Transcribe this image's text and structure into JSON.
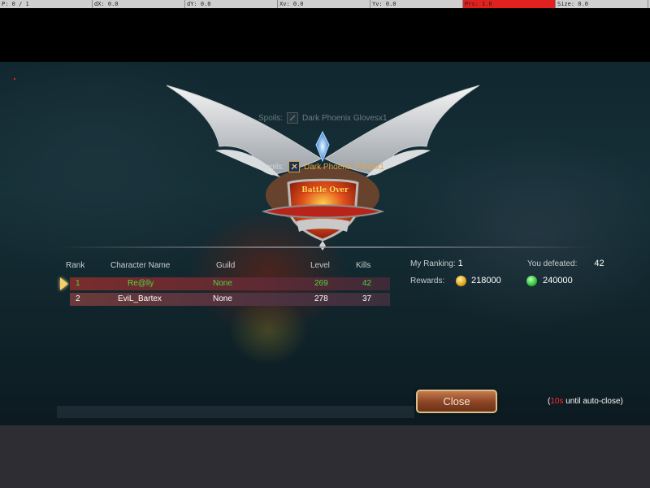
{
  "debug_bar": {
    "cells": [
      {
        "text": "P: 0 / 1",
        "highlight": false
      },
      {
        "text": "dX: 0.0",
        "highlight": false
      },
      {
        "text": "dY: 0.0",
        "highlight": false
      },
      {
        "text": "Xv: 0.0",
        "highlight": false
      },
      {
        "text": "Yv: 0.0",
        "highlight": false
      },
      {
        "text": "Prs: 1.0",
        "highlight": true
      },
      {
        "text": "Size: 0.0",
        "highlight": false
      }
    ]
  },
  "spoils": [
    {
      "label": "Spoils:",
      "item": "Dark Phoenix Glovesx1",
      "faded": true
    },
    {
      "label": "Spoils:",
      "item": "Dark Phoenix Pantsx1",
      "faded": false
    }
  ],
  "banner": {
    "text": "Battle Over"
  },
  "table": {
    "headers": {
      "rank": "Rank",
      "name": "Character Name",
      "guild": "Guild",
      "level": "Level",
      "kills": "Kills"
    },
    "rows": [
      {
        "rank": "1",
        "name": "Re@lly",
        "guild": "None",
        "level": "269",
        "kills": "42"
      },
      {
        "rank": "2",
        "name": "EviL_Bartex",
        "guild": "None",
        "level": "278",
        "kills": "37"
      }
    ]
  },
  "summary": {
    "my_ranking_label": "My Ranking:",
    "my_ranking_value": "1",
    "defeated_label": "You defeated:",
    "defeated_value": "42",
    "rewards_label": "Rewards:",
    "gold_icon": "gold-coin-icon",
    "gold_value": "218000",
    "jade_icon": "jade-coin-icon",
    "jade_value": "240000"
  },
  "close_button": {
    "label": "Close"
  },
  "autoclose": {
    "open": "(",
    "seconds": "10s",
    "rest": " until auto-close)"
  },
  "colors": {
    "winner_text": "#4fd43f",
    "item_gold": "#e3a73f",
    "countdown_red": "#ff2a2a",
    "highlight_red": "#e0211f"
  }
}
